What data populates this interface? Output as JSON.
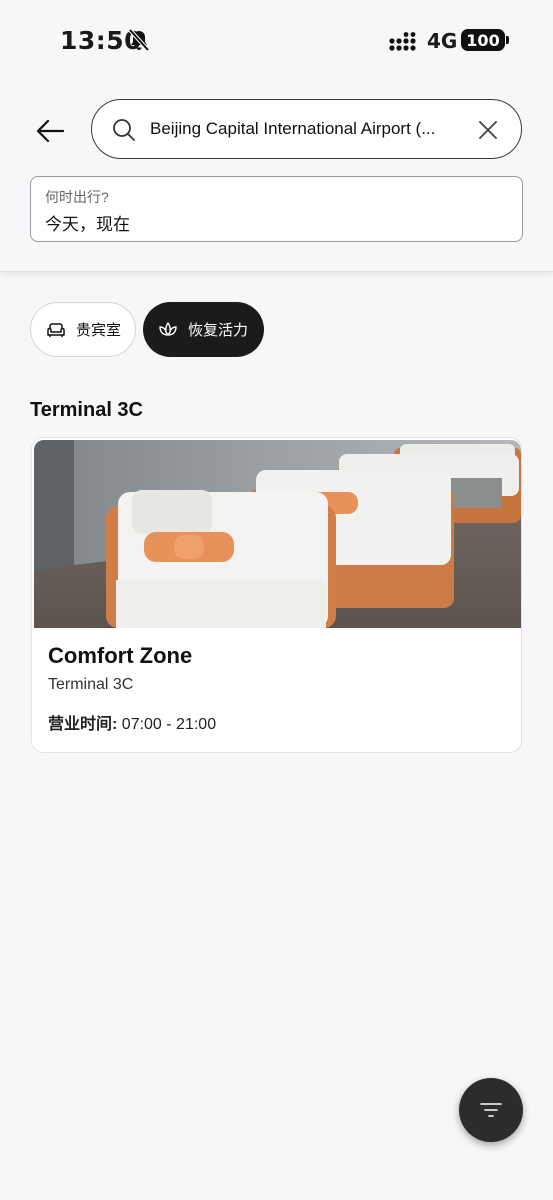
{
  "status_bar": {
    "time": "13:50",
    "network": "4G",
    "battery": "100"
  },
  "search": {
    "value": "Beijing Capital International Airport (..."
  },
  "date": {
    "label": "何时出行?",
    "value": "今天，现在"
  },
  "chips": [
    {
      "label": "贵宾室",
      "icon": "sofa-icon",
      "selected": false
    },
    {
      "label": "恢复活力",
      "icon": "lotus-icon",
      "selected": true
    }
  ],
  "section": {
    "title": "Terminal 3C"
  },
  "card": {
    "title": "Comfort Zone",
    "subtitle": "Terminal 3C",
    "hours_label": "营业时间:",
    "hours_value": " 07:00 - 21:00"
  },
  "fab": {
    "icon": "filter-icon"
  },
  "colors": {
    "background": "#f7f7f9",
    "selected_chip": "#1b1b1b",
    "cushion_orange": "#e8915a"
  }
}
